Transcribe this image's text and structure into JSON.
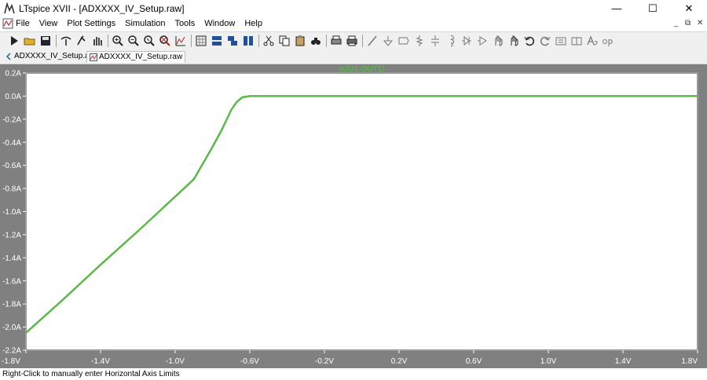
{
  "window": {
    "title": "LTspice XVII - [ADXXXX_IV_Setup.raw]",
    "controls": {
      "minimize": "—",
      "maximize": "☐",
      "close": "✕"
    }
  },
  "menu": {
    "items": [
      "File",
      "View",
      "Plot Settings",
      "Simulation",
      "Tools",
      "Window",
      "Help"
    ],
    "mdi_controls": {
      "minimize": "_",
      "restore": "⧉",
      "close": "✕"
    }
  },
  "toolbar": {
    "icons": [
      "run-icon",
      "open-icon",
      "save-icon",
      "control-panel-icon",
      "halt-icon",
      "pan-icon",
      "zoom-in-icon",
      "zoom-out-icon",
      "zoom-back-icon",
      "zoom-fit-icon",
      "autorange-icon",
      "grid-icon",
      "tile-horizontal-icon",
      "cascade-icon",
      "tile-vertical-icon",
      "cut-icon",
      "copy-icon",
      "paste-icon",
      "find-icon",
      "print-setup-icon",
      "print-icon",
      "draw-wire-icon",
      "ground-icon",
      "label-icon",
      "resistor-icon",
      "capacitor-icon",
      "inductor-icon",
      "diode-icon",
      "component-icon",
      "move-icon",
      "drag-icon",
      "undo-icon",
      "redo-icon",
      "rotate-icon",
      "mirror-icon",
      "text-icon",
      "spice-directive-icon"
    ]
  },
  "tabs": [
    {
      "label": "ADXXXX_IV_Setup.asc",
      "active": false
    },
    {
      "label": "ADXXXX_IV_Setup.raw",
      "active": true
    }
  ],
  "status": {
    "text": "Right-Click to manually enter Horizontal Axis Limits"
  },
  "colors": {
    "trace": "#5ab947",
    "plot_border": "#999999",
    "plot_bg": "#ffffff",
    "window_bg": "#808080",
    "axis_text": "#ffffff"
  },
  "chart_data": {
    "type": "line",
    "title": "Ix(U1:OUT1)",
    "xlim": [
      -1.8,
      1.8
    ],
    "ylim": [
      -2.2,
      0.2
    ],
    "x_ticks": [
      -1.8,
      -1.4,
      -1.0,
      -0.6,
      -0.2,
      0.2,
      0.6,
      1.0,
      1.4,
      1.8
    ],
    "x_tick_labels": [
      "-1.8V",
      "-1.4V",
      "-1.0V",
      "-0.6V",
      "-0.2V",
      "0.2V",
      "0.6V",
      "1.0V",
      "1.4V",
      "1.8V"
    ],
    "y_ticks": [
      0.2,
      0.0,
      -0.2,
      -0.4,
      -0.6,
      -0.8,
      -1.0,
      -1.2,
      -1.4,
      -1.6,
      -1.8,
      -2.0,
      -2.2
    ],
    "y_tick_labels": [
      "0.2A",
      "0.0A",
      "-0.2A",
      "-0.4A",
      "-0.6A",
      "-0.8A",
      "-1.0A",
      "-1.2A",
      "-1.4A",
      "-1.6A",
      "-1.8A",
      "-2.0A",
      "-2.2A"
    ],
    "grid": false,
    "series": [
      {
        "name": "Ix(U1:OUT1)",
        "x": [
          -1.8,
          -1.6,
          -1.4,
          -1.2,
          -1.0,
          -0.9,
          -0.8,
          -0.75,
          -0.7,
          -0.67,
          -0.64,
          -0.6,
          -0.5,
          0.0,
          0.5,
          1.0,
          1.5,
          1.8
        ],
        "y": [
          -2.05,
          -1.76,
          -1.46,
          -1.17,
          -0.87,
          -0.72,
          -0.44,
          -0.29,
          -0.12,
          -0.05,
          -0.01,
          0.0,
          0.0,
          0.0,
          0.0,
          0.0,
          0.0,
          0.0
        ]
      }
    ]
  }
}
